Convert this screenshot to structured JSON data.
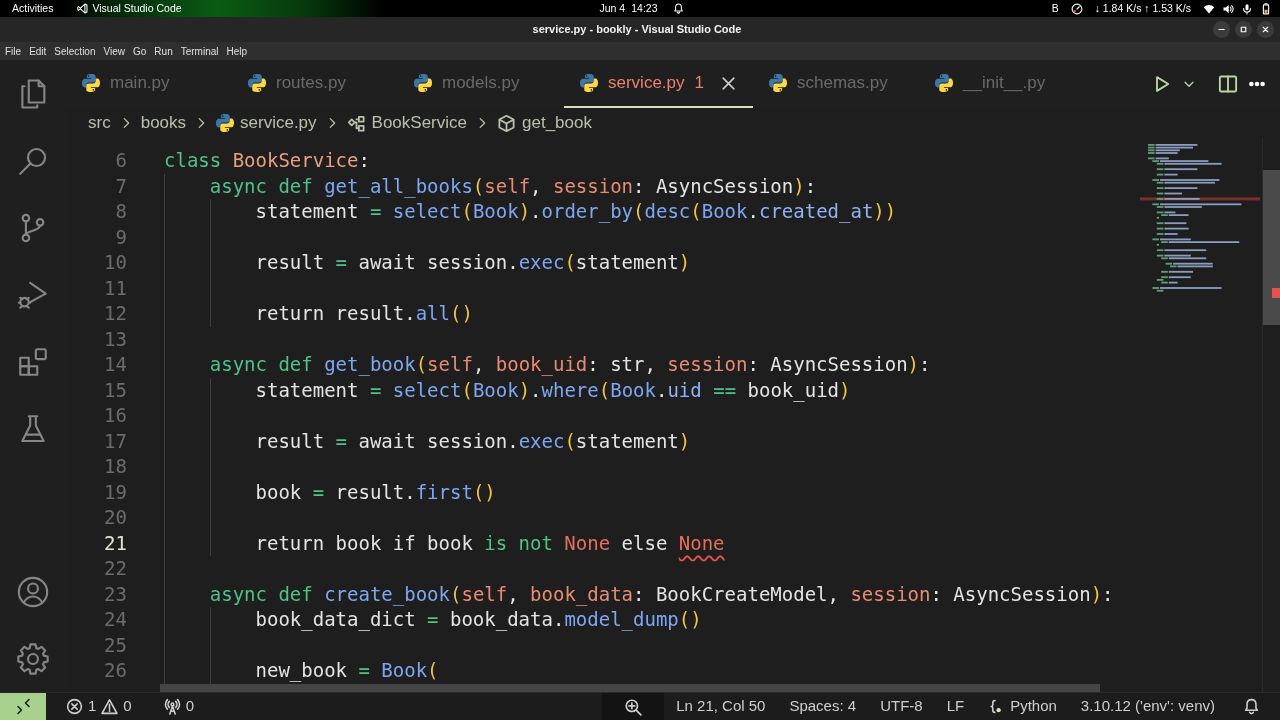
{
  "system_bar": {
    "activities": "Activities",
    "app_name": "Visual Studio Code",
    "date": "Jun 4",
    "time": "14:23",
    "indicator": "B",
    "network_speed": "↓ 1.84 K/s ↑ 1.53 K/s"
  },
  "window": {
    "title": "service.py - bookly - Visual Studio Code"
  },
  "menu": [
    "File",
    "Edit",
    "Selection",
    "View",
    "Go",
    "Run",
    "Terminal",
    "Help"
  ],
  "tabs": [
    {
      "label": "main.py",
      "selected": false
    },
    {
      "label": "routes.py",
      "selected": false
    },
    {
      "label": "models.py",
      "selected": false
    },
    {
      "label": "service.py",
      "problems": "1",
      "selected": true
    },
    {
      "label": "schemas.py",
      "selected": false
    },
    {
      "label": "__init__.py",
      "selected": false
    }
  ],
  "breadcrumbs": [
    {
      "label": "src",
      "kind": "folder"
    },
    {
      "label": "books",
      "kind": "folder"
    },
    {
      "label": "service.py",
      "kind": "file"
    },
    {
      "label": "BookService",
      "kind": "class"
    },
    {
      "label": "get_book",
      "kind": "method"
    }
  ],
  "editor": {
    "lines": [
      {
        "number": "6",
        "current": false,
        "tokens": [
          {
            "text": "class ",
            "kind": "keyword"
          },
          {
            "text": "BookService",
            "kind": "class_name"
          },
          {
            "text": ":",
            "kind": "plain"
          }
        ],
        "children": [
          {
            "number": "7",
            "current": false,
            "tokens": [
              {
                "text": "async def ",
                "kind": "keyword"
              },
              {
                "text": "get_all_books",
                "kind": "function"
              },
              {
                "text": "(",
                "kind": "bracket"
              },
              {
                "text": "self",
                "kind": "parameter"
              },
              {
                "text": ", ",
                "kind": "plain"
              },
              {
                "text": "session",
                "kind": "parameter"
              },
              {
                "text": ": AsyncSession",
                "kind": "plain"
              },
              {
                "text": ")",
                "kind": "bracket"
              },
              {
                "text": ":",
                "kind": "plain"
              }
            ],
            "children": [
              {
                "number": "8",
                "current": false,
                "tokens": [
                  {
                    "text": "statement ",
                    "kind": "plain"
                  },
                  {
                    "text": "= ",
                    "kind": "operator"
                  },
                  {
                    "text": "select",
                    "kind": "function"
                  },
                  {
                    "text": "(",
                    "kind": "bracket"
                  },
                  {
                    "text": "Book",
                    "kind": "function"
                  },
                  {
                    "text": ")",
                    "kind": "bracket"
                  },
                  {
                    "text": ".",
                    "kind": "plain"
                  },
                  {
                    "text": "order_by",
                    "kind": "function"
                  },
                  {
                    "text": "(",
                    "kind": "bracket"
                  },
                  {
                    "text": "desc",
                    "kind": "function"
                  },
                  {
                    "text": "(",
                    "kind": "bracket"
                  },
                  {
                    "text": "Book",
                    "kind": "function"
                  },
                  {
                    "text": ".",
                    "kind": "plain"
                  },
                  {
                    "text": "created_at",
                    "kind": "attribute"
                  },
                  {
                    "text": "))",
                    "kind": "bracket"
                  }
                ]
              },
              {
                "number": "9",
                "current": false
              },
              {
                "number": "10",
                "current": false,
                "tokens": [
                  {
                    "text": "result ",
                    "kind": "plain"
                  },
                  {
                    "text": "=",
                    "kind": "operator"
                  },
                  {
                    "text": " await session.",
                    "kind": "plain"
                  },
                  {
                    "text": "exec",
                    "kind": "function"
                  },
                  {
                    "text": "(",
                    "kind": "bracket"
                  },
                  {
                    "text": "statement",
                    "kind": "plain"
                  },
                  {
                    "text": ")",
                    "kind": "bracket"
                  }
                ]
              },
              {
                "number": "11",
                "current": false
              },
              {
                "number": "12",
                "current": false,
                "tokens": [
                  {
                    "text": "return result.",
                    "kind": "plain"
                  },
                  {
                    "text": "all",
                    "kind": "function"
                  },
                  {
                    "text": "()",
                    "kind": "bracket"
                  }
                ]
              }
            ]
          },
          {
            "number": "13",
            "current": false
          },
          {
            "number": "14",
            "current": false,
            "tokens": [
              {
                "text": "async def ",
                "kind": "keyword"
              },
              {
                "text": "get_book",
                "kind": "function"
              },
              {
                "text": "(",
                "kind": "bracket"
              },
              {
                "text": "self",
                "kind": "parameter"
              },
              {
                "text": ", ",
                "kind": "plain"
              },
              {
                "text": "book_uid",
                "kind": "parameter"
              },
              {
                "text": ": str, ",
                "kind": "plain"
              },
              {
                "text": "session",
                "kind": "parameter"
              },
              {
                "text": ": AsyncSession",
                "kind": "plain"
              },
              {
                "text": ")",
                "kind": "bracket"
              },
              {
                "text": ":",
                "kind": "plain"
              }
            ],
            "children": [
              {
                "number": "15",
                "current": false,
                "tokens": [
                  {
                    "text": "statement ",
                    "kind": "plain"
                  },
                  {
                    "text": "= ",
                    "kind": "operator"
                  },
                  {
                    "text": "select",
                    "kind": "function"
                  },
                  {
                    "text": "(",
                    "kind": "bracket"
                  },
                  {
                    "text": "Book",
                    "kind": "function"
                  },
                  {
                    "text": ")",
                    "kind": "bracket"
                  },
                  {
                    "text": ".",
                    "kind": "plain"
                  },
                  {
                    "text": "where",
                    "kind": "function"
                  },
                  {
                    "text": "(",
                    "kind": "bracket"
                  },
                  {
                    "text": "Book",
                    "kind": "function"
                  },
                  {
                    "text": ".",
                    "kind": "plain"
                  },
                  {
                    "text": "uid ",
                    "kind": "attribute"
                  },
                  {
                    "text": "==",
                    "kind": "operator"
                  },
                  {
                    "text": " book_uid",
                    "kind": "plain"
                  },
                  {
                    "text": ")",
                    "kind": "bracket"
                  }
                ]
              },
              {
                "number": "16",
                "current": false
              },
              {
                "number": "17",
                "current": false,
                "tokens": [
                  {
                    "text": "result ",
                    "kind": "plain"
                  },
                  {
                    "text": "=",
                    "kind": "operator"
                  },
                  {
                    "text": " await session.",
                    "kind": "plain"
                  },
                  {
                    "text": "exec",
                    "kind": "function"
                  },
                  {
                    "text": "(",
                    "kind": "bracket"
                  },
                  {
                    "text": "statement",
                    "kind": "plain"
                  },
                  {
                    "text": ")",
                    "kind": "bracket"
                  }
                ]
              },
              {
                "number": "18",
                "current": false
              },
              {
                "number": "19",
                "current": false,
                "tokens": [
                  {
                    "text": "book ",
                    "kind": "plain"
                  },
                  {
                    "text": "=",
                    "kind": "operator"
                  },
                  {
                    "text": " result.",
                    "kind": "plain"
                  },
                  {
                    "text": "first",
                    "kind": "function"
                  },
                  {
                    "text": "()",
                    "kind": "bracket"
                  }
                ]
              },
              {
                "number": "20",
                "current": false
              },
              {
                "number": "21",
                "current": true,
                "tokens": [
                  {
                    "text": "return book if book ",
                    "kind": "plain"
                  },
                  {
                    "text": "is not ",
                    "kind": "keyword"
                  },
                  {
                    "text": "None",
                    "kind": "constant"
                  },
                  {
                    "text": " else ",
                    "kind": "plain"
                  },
                  {
                    "text": "None",
                    "kind": "constant",
                    "error": true
                  }
                ]
              }
            ]
          },
          {
            "number": "22",
            "current": false
          },
          {
            "number": "23",
            "current": false,
            "tokens": [
              {
                "text": "async def ",
                "kind": "keyword"
              },
              {
                "text": "create_book",
                "kind": "function"
              },
              {
                "text": "(",
                "kind": "bracket"
              },
              {
                "text": "self",
                "kind": "parameter"
              },
              {
                "text": ", ",
                "kind": "plain"
              },
              {
                "text": "book_data",
                "kind": "parameter"
              },
              {
                "text": ": BookCreateModel, ",
                "kind": "plain"
              },
              {
                "text": "session",
                "kind": "parameter"
              },
              {
                "text": ": AsyncSession",
                "kind": "plain"
              },
              {
                "text": ")",
                "kind": "bracket"
              },
              {
                "text": ":",
                "kind": "plain"
              }
            ],
            "children": [
              {
                "number": "24",
                "current": false,
                "tokens": [
                  {
                    "text": "book_data_dict ",
                    "kind": "plain"
                  },
                  {
                    "text": "=",
                    "kind": "operator"
                  },
                  {
                    "text": " book_data.",
                    "kind": "plain"
                  },
                  {
                    "text": "model_dump",
                    "kind": "function"
                  },
                  {
                    "text": "()",
                    "kind": "bracket"
                  }
                ]
              },
              {
                "number": "25",
                "current": false
              },
              {
                "number": "26",
                "current": false,
                "tokens": [
                  {
                    "text": "new_book ",
                    "kind": "plain"
                  },
                  {
                    "text": "= ",
                    "kind": "operator"
                  },
                  {
                    "text": "Book",
                    "kind": "function"
                  },
                  {
                    "text": "(",
                    "kind": "bracket"
                  }
                ]
              }
            ]
          }
        ]
      }
    ]
  },
  "status_bar": {
    "errors": "1",
    "warnings": "0",
    "ports": "0",
    "cursor_position": "Ln 21, Col 50",
    "indentation": "Spaces: 4",
    "encoding": "UTF-8",
    "line_ending": "LF",
    "language": "Python",
    "interpreter": "3.10.12 ('env': venv)"
  }
}
